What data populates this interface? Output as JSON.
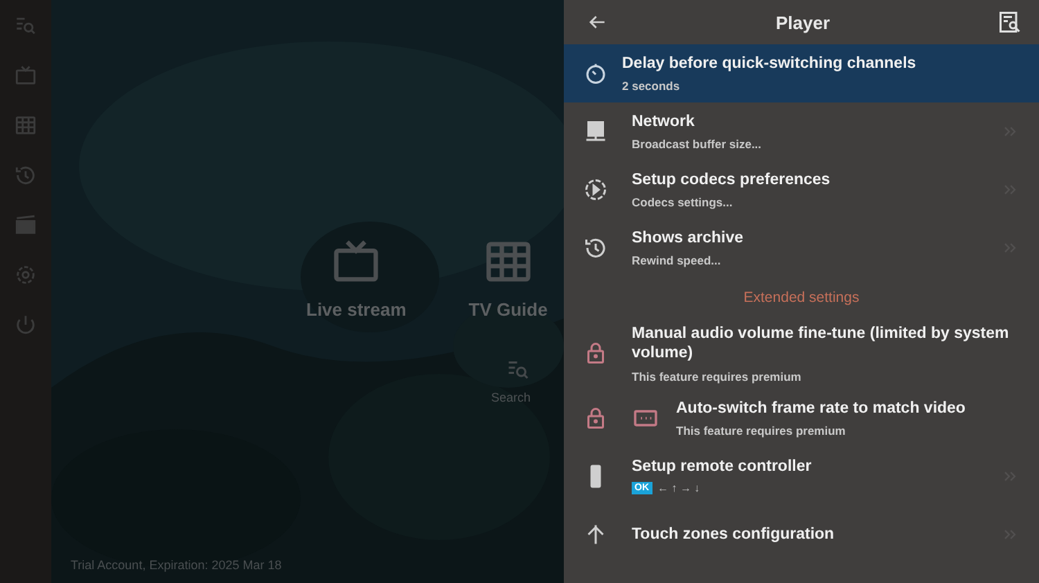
{
  "home": {
    "tiles": [
      {
        "label": "Live stream"
      },
      {
        "label": "TV Guide"
      }
    ],
    "search": {
      "label": "Search"
    },
    "footer": "Trial Account, Expiration: 2025 Mar 18"
  },
  "panel": {
    "title": "Player",
    "items": [
      {
        "kind": "link",
        "title": "Delay before quick-switching channels",
        "subtitle": "2 seconds",
        "selected": true
      },
      {
        "kind": "link",
        "title": "Network",
        "subtitle": "Broadcast buffer size...",
        "selected": false
      },
      {
        "kind": "link",
        "title": "Setup codecs preferences",
        "subtitle": "Codecs settings...",
        "selected": false
      },
      {
        "kind": "link",
        "title": "Shows archive",
        "subtitle": "Rewind speed...",
        "selected": false
      },
      {
        "kind": "section",
        "title": "Extended settings"
      },
      {
        "kind": "locked",
        "title": "Manual audio volume fine-tune (limited by system volume)",
        "subtitle": "This feature requires premium"
      },
      {
        "kind": "locked",
        "title": "Auto-switch frame rate to match video",
        "subtitle": "This feature requires premium"
      },
      {
        "kind": "keys",
        "title": "Setup remote controller",
        "badge": "OK",
        "keys": "← ↑ → ↓",
        "selected": false
      },
      {
        "kind": "link",
        "title": "Touch zones configuration",
        "selected": false
      }
    ]
  }
}
